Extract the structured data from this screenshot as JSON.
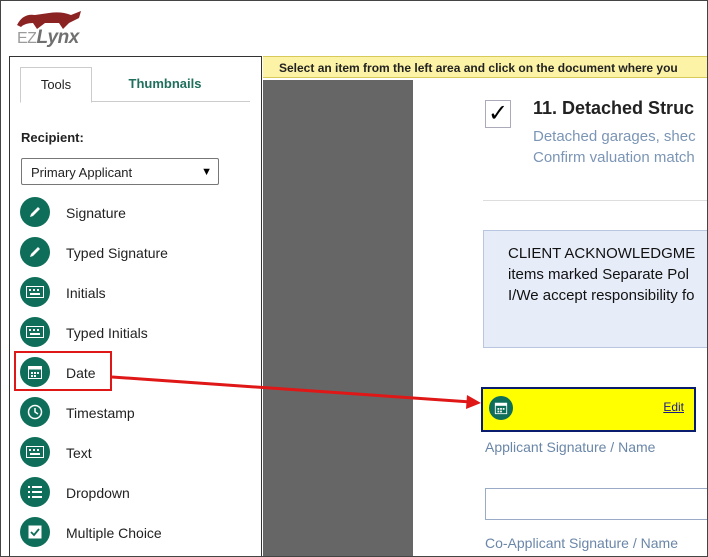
{
  "header": {
    "logo_ez": "EZ",
    "logo_lynx": "Lynx"
  },
  "left_panel": {
    "tabs": [
      {
        "label": "Tools"
      },
      {
        "label": "Thumbnails"
      }
    ],
    "recipient_label": "Recipient:",
    "recipient_value": "Primary Applicant",
    "tools": [
      {
        "label": "Signature",
        "icon": "pen-icon"
      },
      {
        "label": "Typed Signature",
        "icon": "pen-icon"
      },
      {
        "label": "Initials",
        "icon": "keyboard-icon"
      },
      {
        "label": "Typed Initials",
        "icon": "keyboard-icon"
      },
      {
        "label": "Date",
        "icon": "calendar-icon"
      },
      {
        "label": "Timestamp",
        "icon": "clock-icon"
      },
      {
        "label": "Text",
        "icon": "keyboard-icon"
      },
      {
        "label": "Dropdown",
        "icon": "list-icon"
      },
      {
        "label": "Multiple Choice",
        "icon": "checkbox-icon"
      }
    ]
  },
  "viewer": {
    "instruction": "Select an item from the left area and click on the document where you",
    "section": {
      "checkmark": "✓",
      "title": "11. Detached Struc",
      "line1": "Detached garages, shec",
      "line2": "Confirm valuation match"
    },
    "acknowledgement": [
      "CLIENT ACKNOWLEDGME",
      "items marked Separate Pol",
      "I/We accept responsibility fo"
    ],
    "date_field": {
      "edit_label": "Edit"
    },
    "applicant_label": "Applicant Signature / Name",
    "co_applicant_label": "Co-Applicant Signature / Name"
  },
  "colors": {
    "tool_icon": "#0f6e59",
    "highlight": "#e01717",
    "banner": "#fcf3a6",
    "date_field": "#ffff00"
  }
}
